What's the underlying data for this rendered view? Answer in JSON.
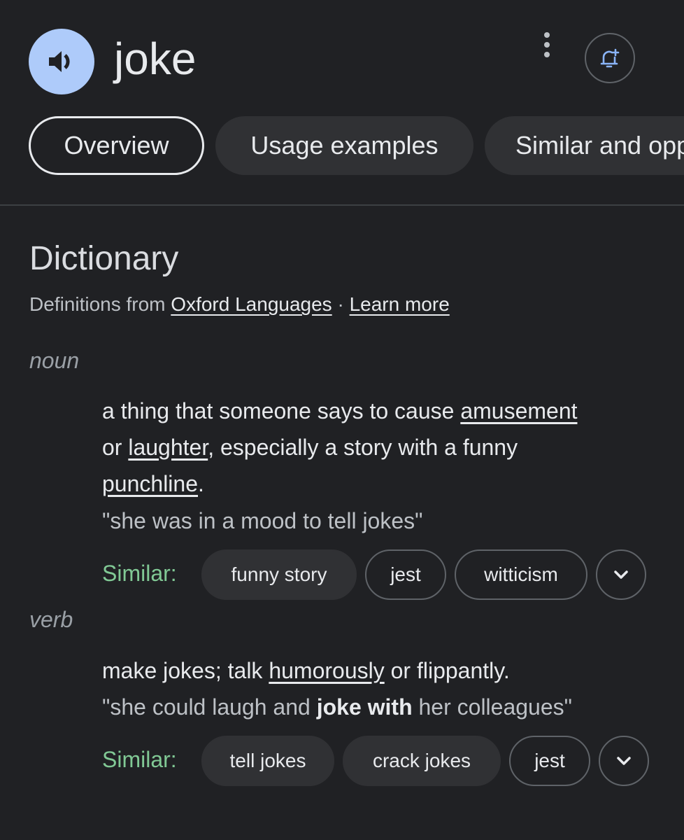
{
  "header": {
    "word": "joke",
    "speaker_icon": "speaker-icon",
    "more_icon": "more-vert-icon",
    "alert_icon": "add-alert-icon",
    "accent": "#aecbfa"
  },
  "tabs": [
    {
      "label": "Overview",
      "active": true
    },
    {
      "label": "Usage examples",
      "active": false
    },
    {
      "label": "Similar and opposite words",
      "active": false
    }
  ],
  "dictionary": {
    "title": "Dictionary",
    "source_prefix": "Definitions from ",
    "source_link": "Oxford Languages",
    "separator": " · ",
    "learn_more": "Learn more"
  },
  "entries": [
    {
      "part_of_speech": "noun",
      "definition": {
        "t1": "a thing that someone says to cause ",
        "link1": "amusement",
        "t2": " or ",
        "link2": "laughter",
        "t3": ", especially a story with a funny ",
        "link3": "punchline",
        "t4": "."
      },
      "example": "\"she was in a mood to tell jokes\"",
      "similar_label": "Similar:",
      "similar": [
        "funny story",
        "jest",
        "witticism"
      ],
      "expand_icon": "chevron-down-icon"
    },
    {
      "part_of_speech": "verb",
      "definition": {
        "t1": "make jokes; talk ",
        "link1": "humorously",
        "t2": " or flippantly."
      },
      "example": {
        "before": "\"she could laugh and ",
        "bold": "joke with",
        "after": " her colleagues\""
      },
      "similar_label": "Similar:",
      "similar": [
        "tell jokes",
        "crack jokes",
        "jest"
      ],
      "expand_icon": "chevron-down-icon"
    }
  ]
}
